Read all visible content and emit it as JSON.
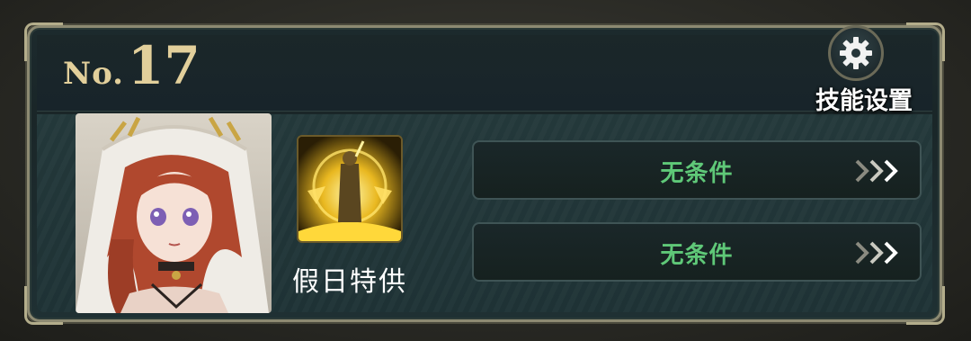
{
  "card": {
    "no_prefix": "No.",
    "number": "17"
  },
  "settings": {
    "label": "技能设置",
    "icon": "gear-icon"
  },
  "character": {
    "portrait": "character-portrait"
  },
  "skill": {
    "name": "假日特供",
    "icon": "skill-icon"
  },
  "conditions": [
    {
      "label": "无条件",
      "icon": "triple-chevron-right-icon"
    },
    {
      "label": "无条件",
      "icon": "triple-chevron-right-icon"
    }
  ],
  "colors": {
    "condition_text": "#5fc878",
    "number_gold": "#e2cf9b",
    "frame": "#8d8a72"
  }
}
